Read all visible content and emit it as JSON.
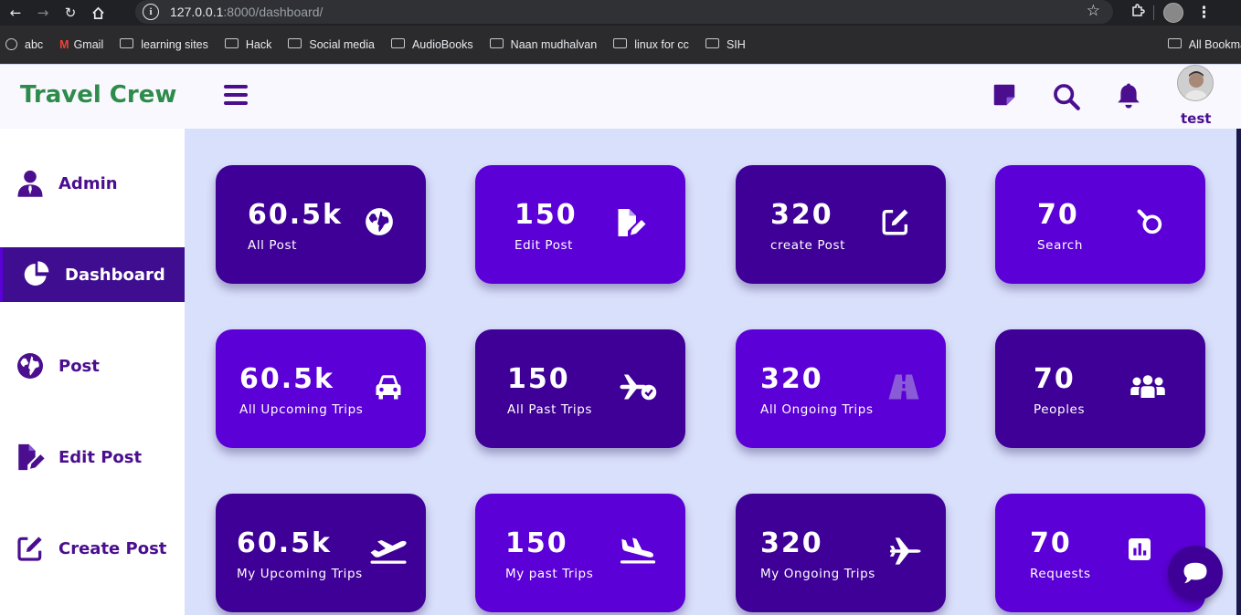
{
  "browser": {
    "url_host": "127.0.0.1",
    "url_path": ":8000/dashboard/",
    "bookmarks": [
      "abc",
      "Gmail",
      "learning sites",
      "Hack",
      "Social media",
      "AudioBooks",
      "Naan mudhalvan",
      "linux for cc",
      "SIH"
    ],
    "all_bookmarks": "All Bookmarks"
  },
  "header": {
    "brand": "Travel Crew",
    "username": "test"
  },
  "sidebar": {
    "items": [
      {
        "label": "Admin",
        "icon": "user-tie-icon"
      },
      {
        "label": "Dashboard",
        "icon": "chart-pie-icon",
        "active": true
      },
      {
        "label": "Post",
        "icon": "globe-icon"
      },
      {
        "label": "Edit Post",
        "icon": "file-pen-icon"
      },
      {
        "label": "Create Post",
        "icon": "pen-square-icon"
      }
    ]
  },
  "cards": [
    {
      "value": "60.5k",
      "caption": "All Post",
      "icon": "globe-icon"
    },
    {
      "value": "150",
      "caption": "Edit Post",
      "icon": "file-pen-icon"
    },
    {
      "value": "320",
      "caption": "create Post",
      "icon": "pen-square-icon"
    },
    {
      "value": "70",
      "caption": "Search",
      "icon": "search-icon"
    },
    {
      "value": "60.5k",
      "caption": "All Upcoming Trips",
      "icon": "car-icon"
    },
    {
      "value": "150",
      "caption": "All Past Trips",
      "icon": "plane-check-icon"
    },
    {
      "value": "320",
      "caption": "All Ongoing Trips",
      "icon": "road-icon"
    },
    {
      "value": "70",
      "caption": "Peoples",
      "icon": "people-group-icon"
    },
    {
      "value": "60.5k",
      "caption": "My Upcoming Trips",
      "icon": "plane-departure-icon"
    },
    {
      "value": "150",
      "caption": "My past Trips",
      "icon": "plane-arrival-icon"
    },
    {
      "value": "320",
      "caption": "My Ongoing Trips",
      "icon": "plane-icon"
    },
    {
      "value": "70",
      "caption": "Requests",
      "icon": "chart-square-icon"
    }
  ],
  "colors": {
    "brand": "#2e8b4a",
    "primary_dark": "#3e0096",
    "primary_bright": "#5b00d6",
    "accent_text": "#4a0e8f",
    "main_bg": "#d9e0fb"
  }
}
